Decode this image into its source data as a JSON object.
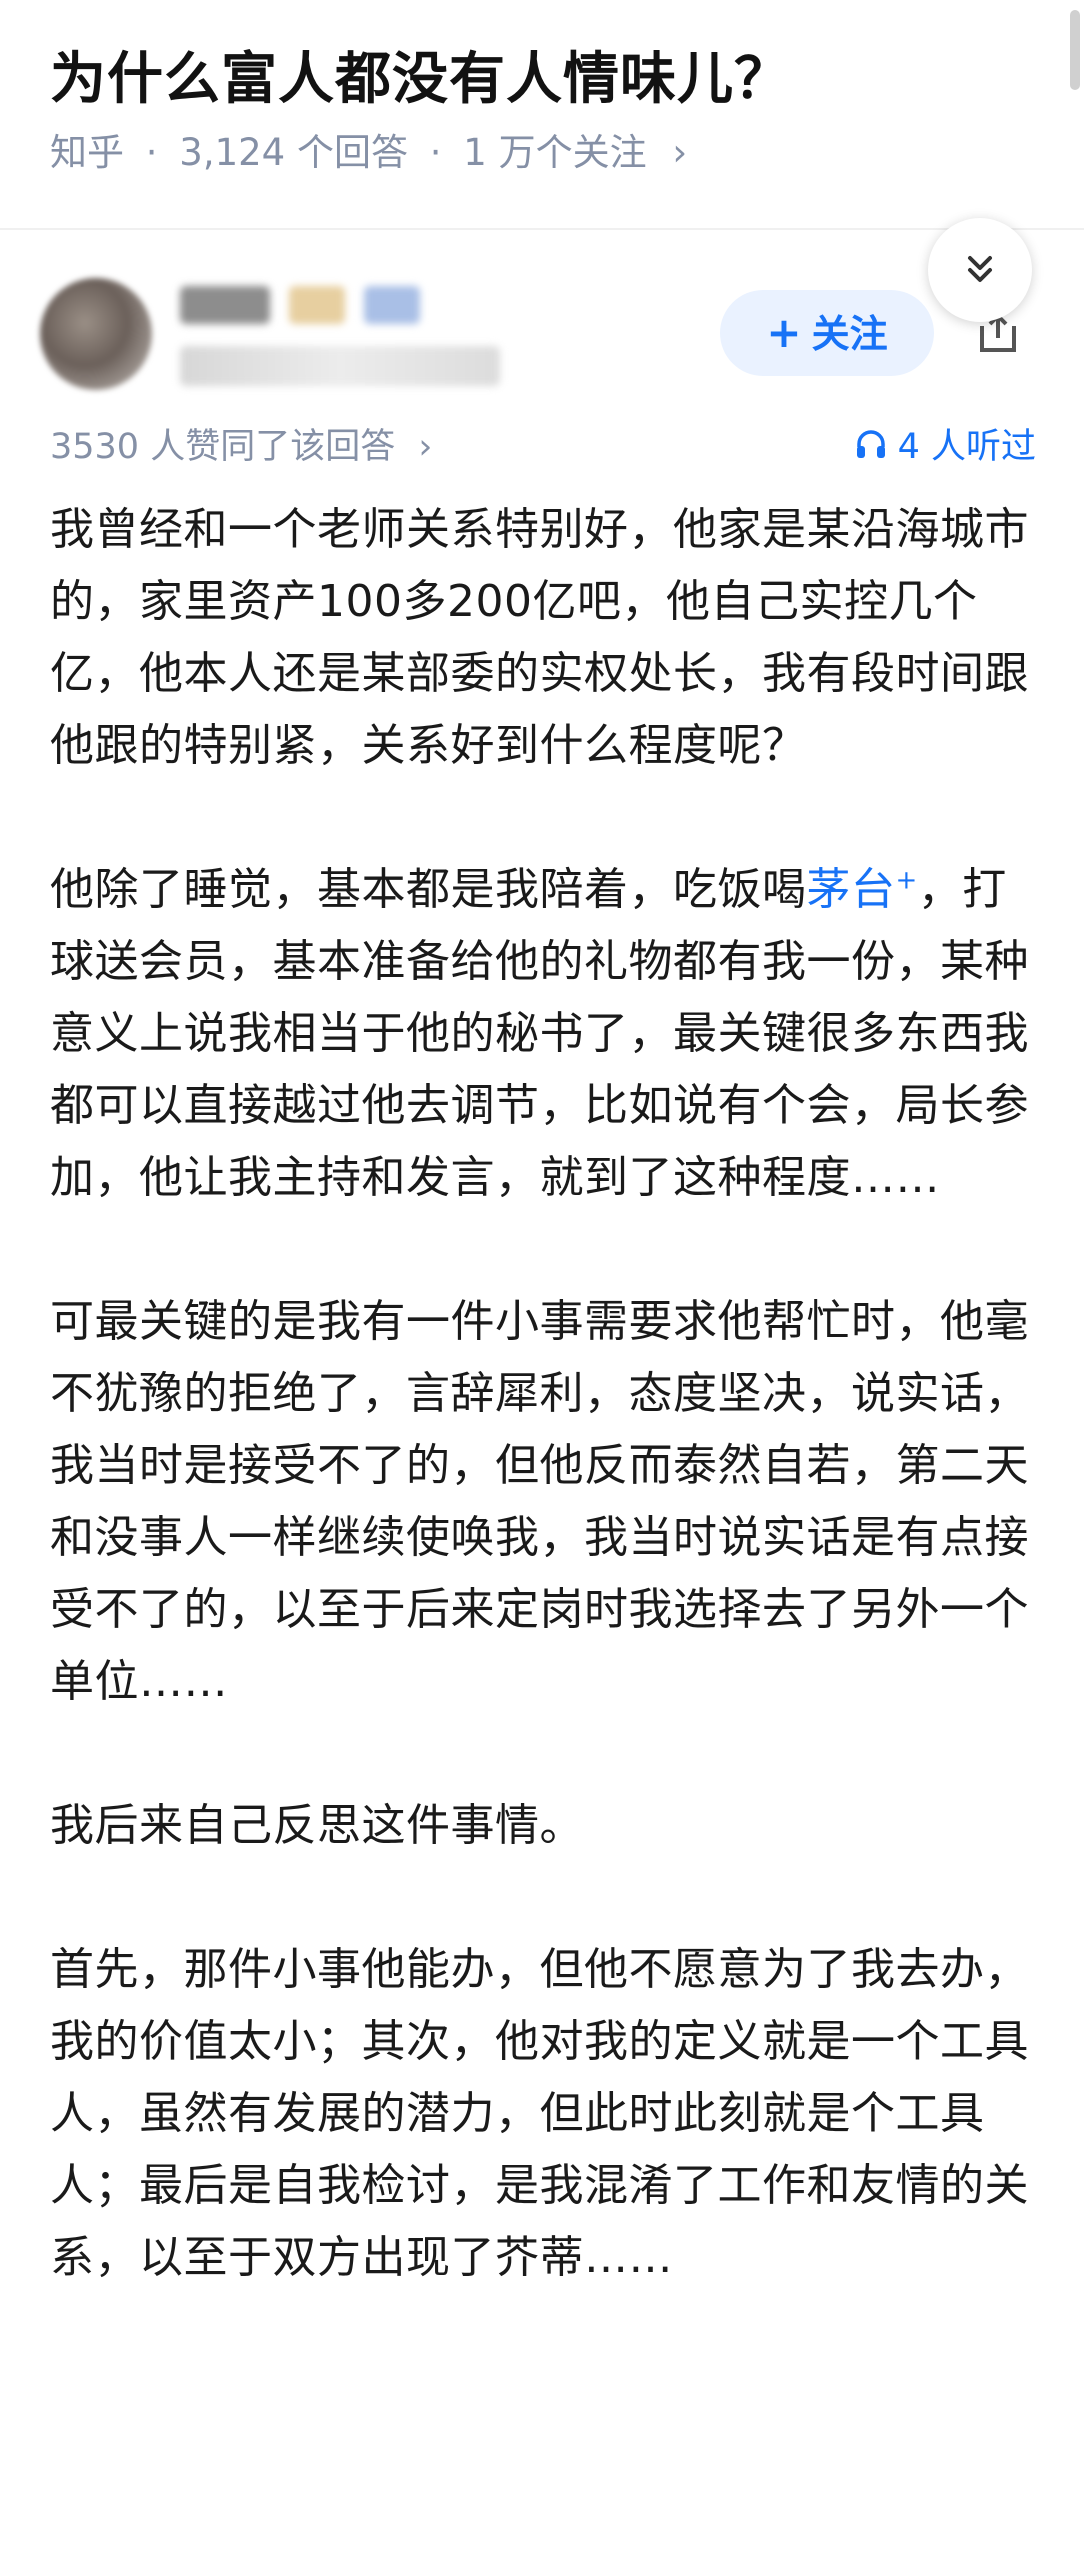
{
  "question": {
    "title": "为什么富人都没有人情味儿？",
    "source": "知乎",
    "answers": "3,124 个回答",
    "followers": "1 万个关注",
    "chevron": "›"
  },
  "author": {
    "follow_label": "关注",
    "follow_icon": "plus-icon"
  },
  "stats": {
    "votes": "3530 人赞同了该回答",
    "votes_chevron": "›",
    "listeners": "4 人听过"
  },
  "answer": {
    "p1": "我曾经和一个老师关系特别好，他家是某沿海城市的，家里资产100多200亿吧，他自己实控几个亿，他本人还是某部委的实权处长，我有段时间跟他跟的特别紧，关系好到什么程度呢？",
    "p2_before": "他除了睡觉，基本都是我陪着，吃饭喝",
    "p2_link": "茅台",
    "p2_link_mark": "+",
    "p2_after": "，打球送会员，基本准备给他的礼物都有我一份，某种意义上说我相当于他的秘书了，最关键很多东西我都可以直接越过他去调节，比如说有个会，局长参加，他让我主持和发言，就到了这种程度……",
    "p3": "可最关键的是我有一件小事需要求他帮忙时，他毫不犹豫的拒绝了，言辞犀利，态度坚决，说实话，我当时是接受不了的，但他反而泰然自若，第二天和没事人一样继续使唤我，我当时说实话是有点接受不了的，以至于后来定岗时我选择去了另外一个单位……",
    "p4": "我后来自己反思这件事情。",
    "p5": "首先，那件小事他能办，但他不愿意为了我去办，我的价值太小；其次，他对我的定义就是一个工具人，虽然有发展的潜力，但此时此刻就是个工具人；最后是自我检讨，是我混淆了工作和友情的关系，以至于双方出现了芥蒂……"
  },
  "colors": {
    "accent": "#1772f6",
    "muted": "#8590a6",
    "text": "#1a1a1a"
  }
}
